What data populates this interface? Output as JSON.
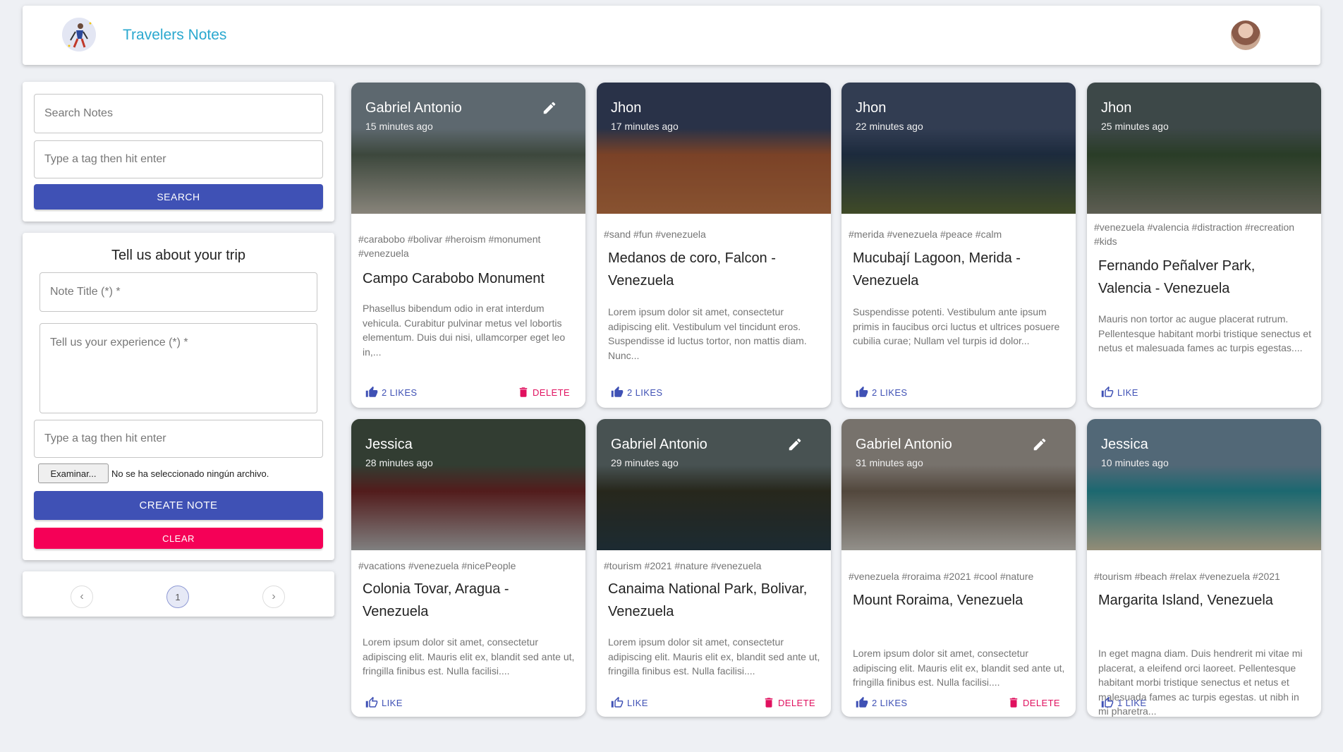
{
  "header": {
    "brand": "Travelers Notes"
  },
  "search": {
    "notes_placeholder": "Search Notes",
    "tag_placeholder": "Type a tag then hit enter",
    "button": "Search"
  },
  "form": {
    "heading": "Tell us about your trip",
    "title_placeholder": "Note Title (*) *",
    "experience_placeholder": "Tell us your experience (*) *",
    "tag_placeholder": "Type a tag then hit enter",
    "file_button": "Examinar...",
    "file_status": "No se ha seleccionado ningún archivo.",
    "create_button": "Create Note",
    "clear_button": "Clear"
  },
  "pagination": {
    "prev": "‹",
    "current": "1",
    "next": "›"
  },
  "colors": {
    "primary": "#3f51b5",
    "secondary": "#f50057",
    "brand": "#2aa8cf"
  },
  "cards": [
    {
      "author": "Gabriel Antonio",
      "time": "15 minutes ago",
      "tags": "#carabobo #bolivar #heroism #monument #venezuela",
      "title": "Campo Carabobo Monument",
      "description": "Phasellus bibendum odio in erat interdum vehicula. Curabitur pulvinar metus vel lobortis elementum. Duis dui nisi, ullamcorper eget leo in,...",
      "likes": "2 Likes",
      "delete": "Delete",
      "editable": true,
      "liked": true
    },
    {
      "author": "Jhon",
      "time": "17 minutes ago",
      "tags": "#sand #fun #venezuela",
      "title": "Medanos de coro, Falcon - Venezuela",
      "description": "Lorem ipsum dolor sit amet, consectetur adipiscing elit. Vestibulum vel tincidunt eros. Suspendisse id luctus tortor, non mattis diam. Nunc...",
      "likes": "2 Likes",
      "delete": "",
      "editable": false,
      "liked": true
    },
    {
      "author": "Jhon",
      "time": "22 minutes ago",
      "tags": "#merida #venezuela #peace #calm",
      "title": "Mucubají Lagoon, Merida - Venezuela",
      "description": "Suspendisse potenti. Vestibulum ante ipsum primis in faucibus orci luctus et ultrices posuere cubilia curae; Nullam vel turpis id dolor...",
      "likes": "2 Likes",
      "delete": "",
      "editable": false,
      "liked": true
    },
    {
      "author": "Jhon",
      "time": "25 minutes ago",
      "tags": "#venezuela #valencia #distraction #recreation #kids",
      "title": "Fernando Peñalver Park, Valencia - Venezuela",
      "description": "Mauris non tortor ac augue placerat rutrum. Pellentesque habitant morbi tristique senectus et netus et malesuada fames ac turpis egestas....",
      "likes": "Like",
      "delete": "",
      "editable": false,
      "liked": false
    },
    {
      "author": "Jessica",
      "time": "28 minutes ago",
      "tags": "#vacations #venezuela #nicePeople",
      "title": "Colonia Tovar, Aragua - Venezuela",
      "description": "Lorem ipsum dolor sit amet, consectetur adipiscing elit. Mauris elit ex, blandit sed ante ut, fringilla finibus est. Nulla facilisi....",
      "likes": "Like",
      "delete": "",
      "editable": false,
      "liked": false
    },
    {
      "author": "Gabriel Antonio",
      "time": "29 minutes ago",
      "tags": "#tourism #2021 #nature #venezuela",
      "title": "Canaima National Park, Bolivar, Venezuela",
      "description": "Lorem ipsum dolor sit amet, consectetur adipiscing elit. Mauris elit ex, blandit sed ante ut, fringilla finibus est. Nulla facilisi....",
      "likes": "Like",
      "delete": "Delete",
      "editable": true,
      "liked": false
    },
    {
      "author": "Gabriel Antonio",
      "time": "31 minutes ago",
      "tags": "#venezuela #roraima #2021 #cool #nature",
      "title": "Mount Roraima, Venezuela",
      "description": "Lorem ipsum dolor sit amet, consectetur adipiscing elit. Mauris elit ex, blandit sed ante ut, fringilla finibus est. Nulla facilisi....",
      "likes": "2 Likes",
      "delete": "Delete",
      "editable": true,
      "liked": true
    },
    {
      "author": "Jessica",
      "time": "10 minutes ago",
      "tags": "#tourism #beach #relax #venezuela #2021",
      "title": "Margarita Island, Venezuela",
      "description": "In eget magna diam. Duis hendrerit mi vitae mi placerat, a eleifend orci laoreet. Pellentesque habitant morbi tristique senectus et netus et malesuada fames ac turpis egestas. ut nibh in mi pharetra...",
      "likes": "1 Like",
      "delete": "",
      "editable": false,
      "liked": false
    }
  ]
}
